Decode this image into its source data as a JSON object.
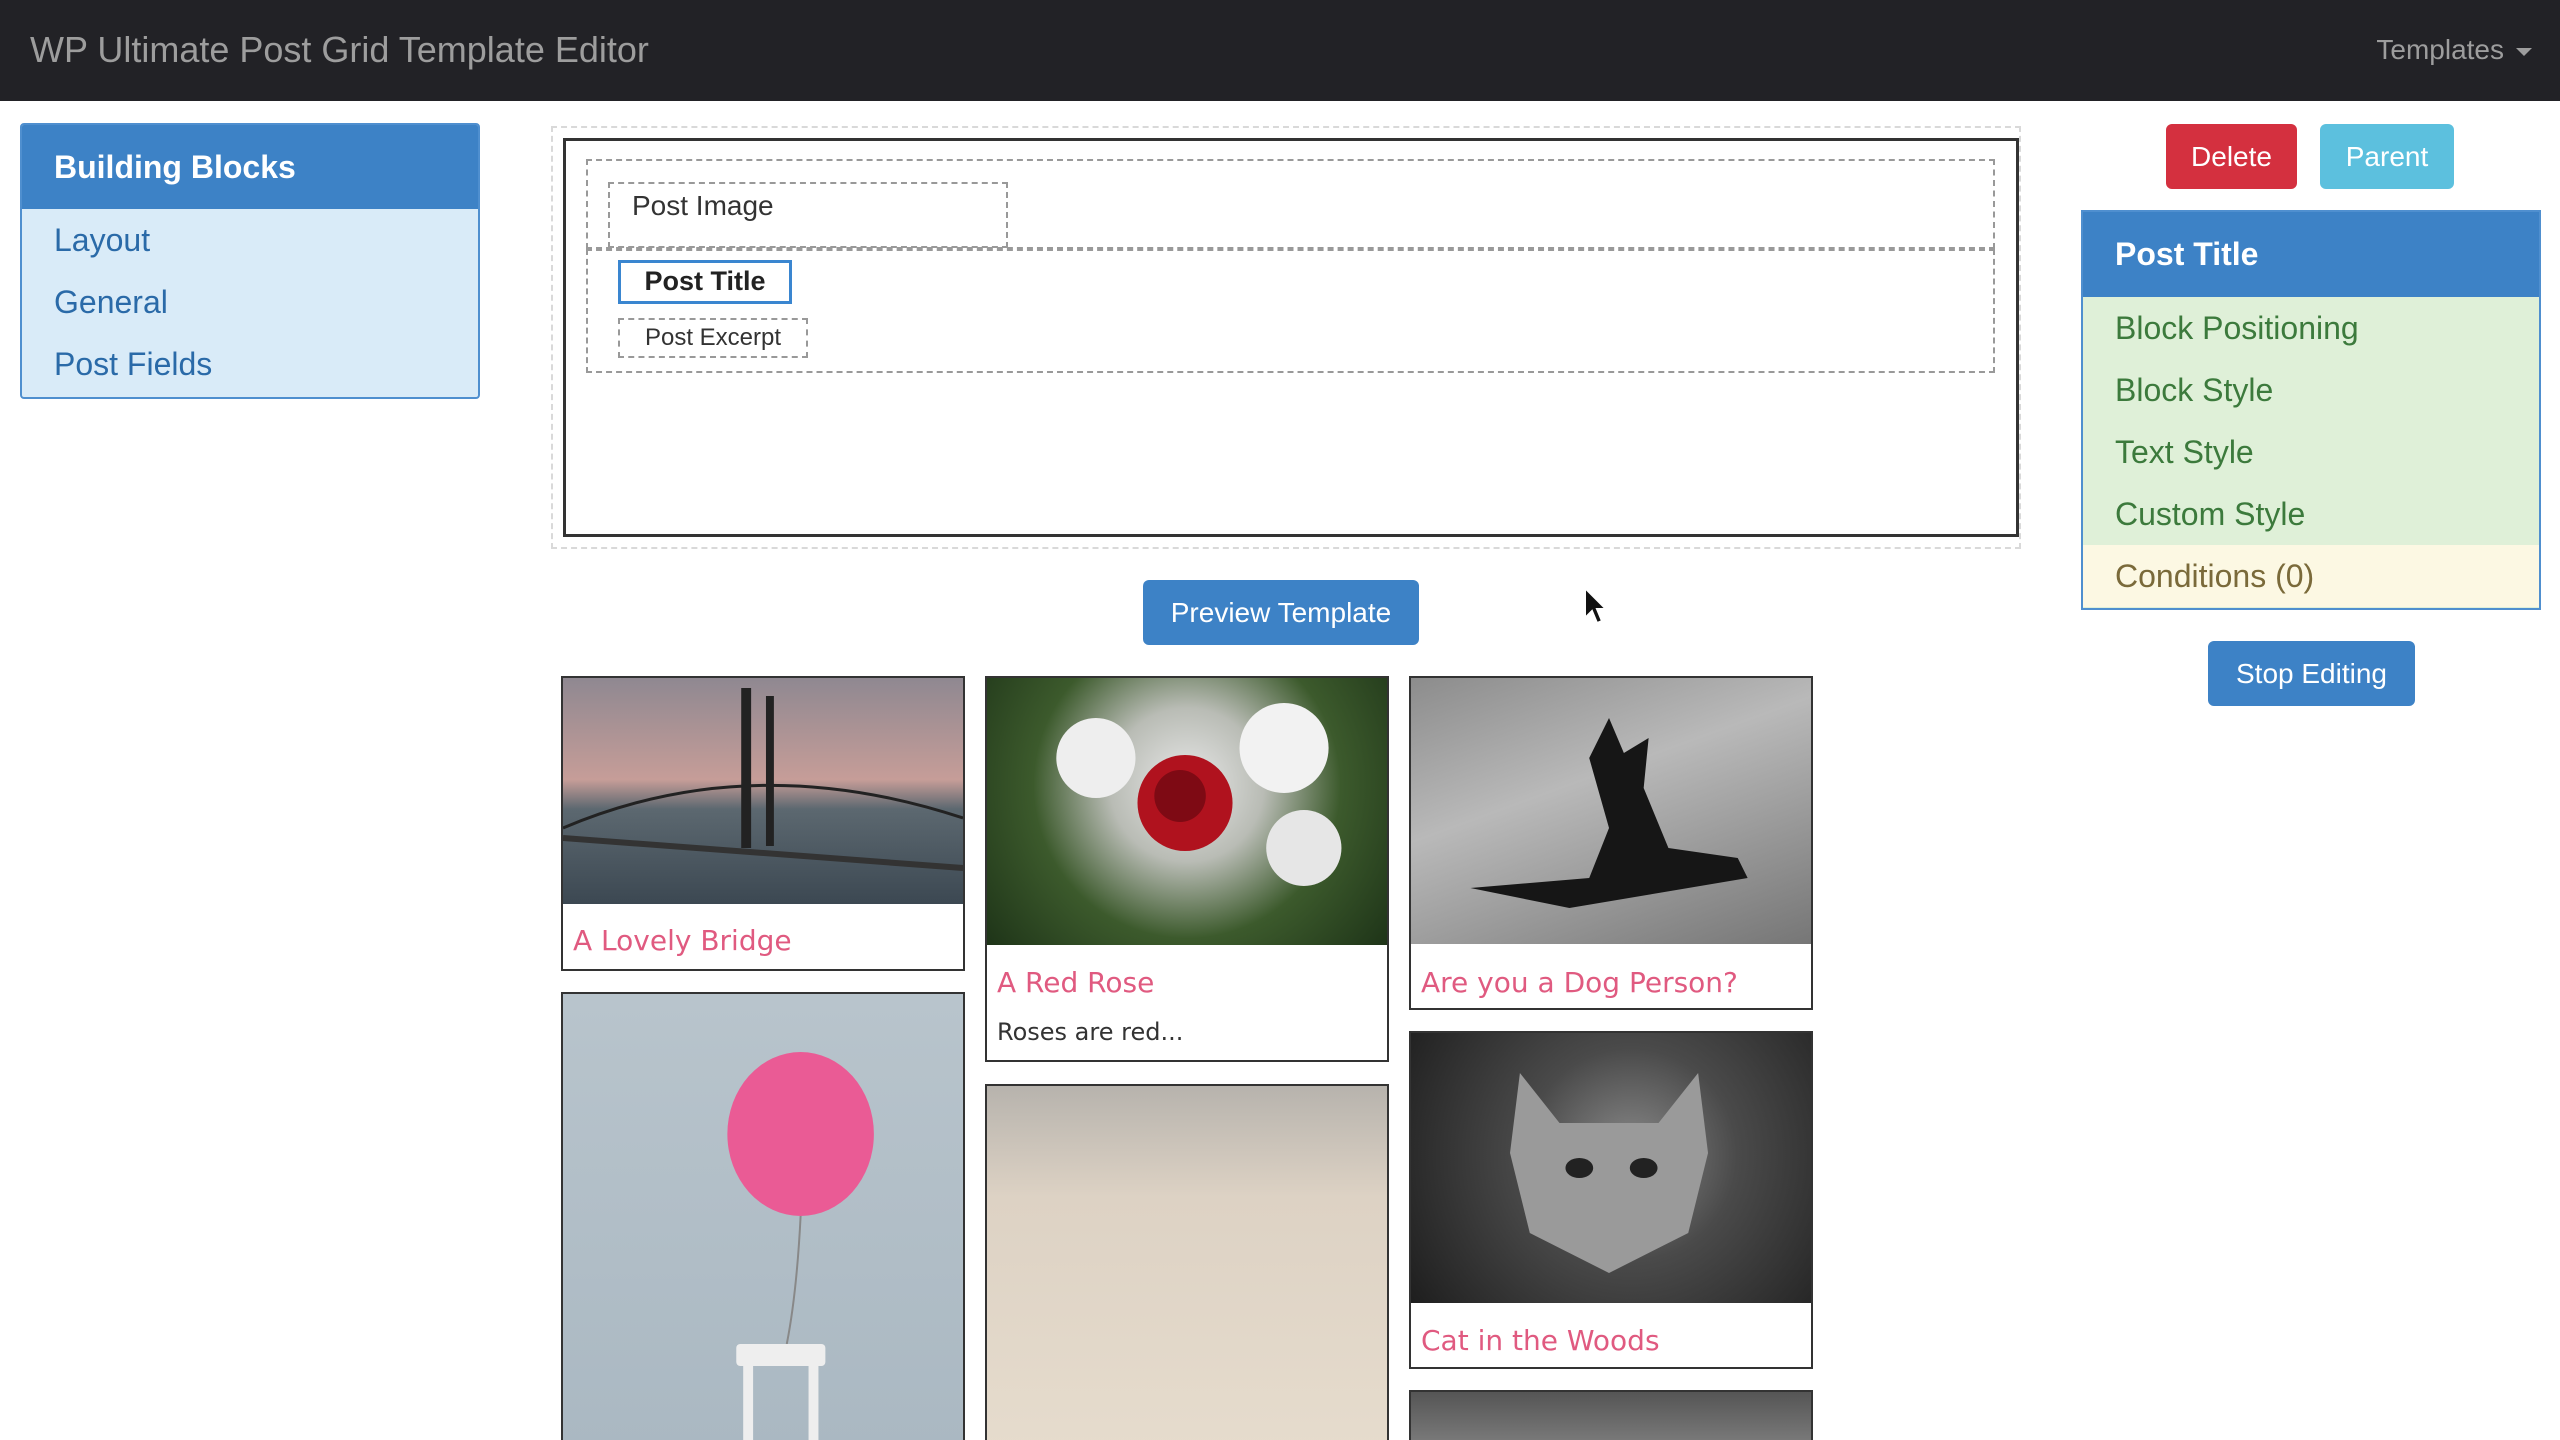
{
  "navbar": {
    "brand": "WP Ultimate Post Grid Template Editor",
    "templates_label": "Templates"
  },
  "building_blocks": {
    "title": "Building Blocks",
    "items": [
      "Layout",
      "General",
      "Post Fields"
    ]
  },
  "editor": {
    "post_image": "Post Image",
    "post_title": "Post Title",
    "post_excerpt": "Post Excerpt"
  },
  "buttons": {
    "preview": "Preview Template",
    "delete": "Delete",
    "parent": "Parent",
    "stop_editing": "Stop Editing"
  },
  "properties": {
    "title": "Post Title",
    "items": [
      "Block Positioning",
      "Block Style",
      "Text Style",
      "Custom Style"
    ],
    "conditions": "Conditions (0)"
  },
  "grid": {
    "posts": [
      {
        "title": "A Lovely Bridge",
        "excerpt": ""
      },
      {
        "title": "A Red Rose",
        "excerpt": "Roses are red..."
      },
      {
        "title": "Are you a Dog Person?",
        "excerpt": ""
      },
      {
        "title": "Cat in the Woods",
        "excerpt": ""
      }
    ]
  },
  "colors": {
    "navbar": "#222226",
    "primary": "#3d82c6",
    "danger": "#d4303f",
    "info": "#5cc0de",
    "post_title_link": "#e05a80"
  }
}
